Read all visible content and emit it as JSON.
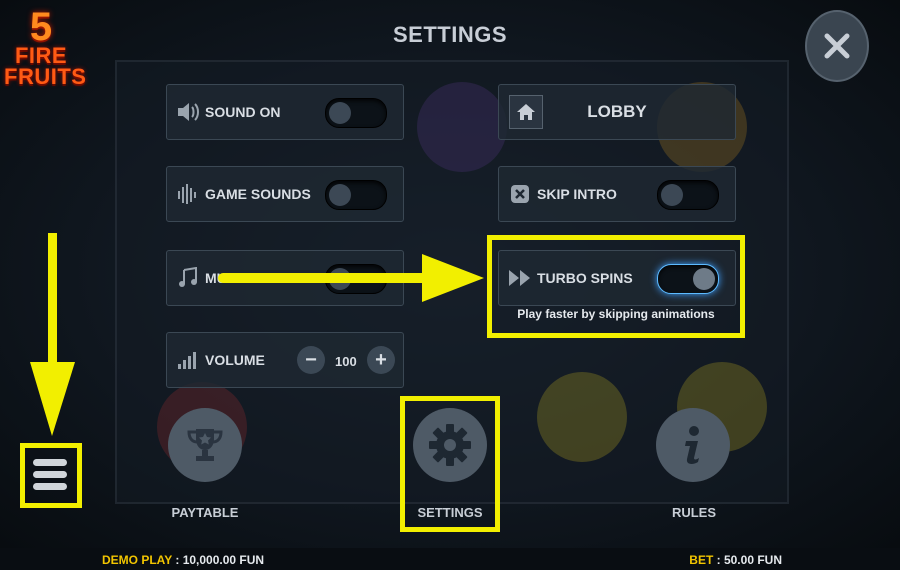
{
  "logo": {
    "number": "5",
    "line1": "FIRE",
    "line2": "FRUITS"
  },
  "title": "SETTINGS",
  "settings": {
    "sound": {
      "label": "SOUND ON",
      "on": false
    },
    "game_sounds": {
      "label": "GAME SOUNDS",
      "on": false
    },
    "music": {
      "label": "MU",
      "on": false
    },
    "volume": {
      "label": "VOLUME",
      "minus": "−",
      "plus": "+",
      "value": "100"
    },
    "lobby": {
      "label": "LOBBY"
    },
    "skip_intro": {
      "label": "SKIP INTRO",
      "on": false
    },
    "turbo_spins": {
      "label": "TURBO SPINS",
      "on": true,
      "hint": "Play faster by skipping animations"
    }
  },
  "bottom_nav": {
    "paytable": "PAYTABLE",
    "settings": "SETTINGS",
    "rules": "RULES"
  },
  "status": {
    "demo_label": "DEMO PLAY",
    "demo_value": " : 10,000.00 FUN",
    "bet_label": "BET",
    "bet_value": " : 50.00 FUN"
  },
  "colors": {
    "highlight": "#f2ef00",
    "accent_glow": "#3fa0ff",
    "logo_fire": "#ff5a14"
  },
  "icons": [
    "speaker-icon",
    "equalizer-icon",
    "music-note-icon",
    "volume-bars-icon",
    "home-icon",
    "skip-icon",
    "fast-forward-icon",
    "trophy-icon",
    "gear-icon",
    "info-icon",
    "close-icon",
    "hamburger-menu-icon"
  ]
}
